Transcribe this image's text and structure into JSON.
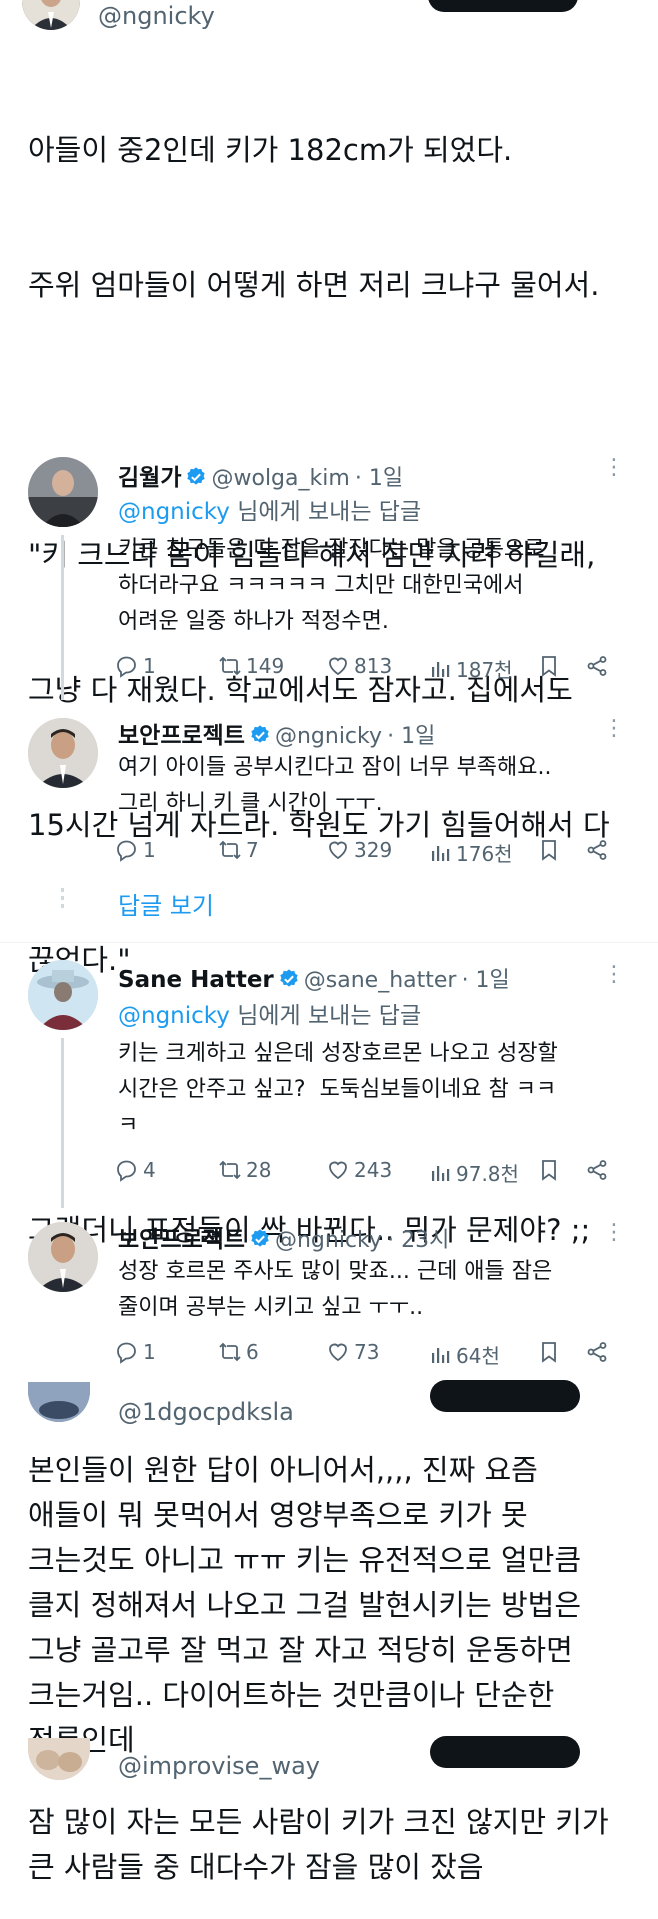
{
  "top_post": {
    "handle": "@ngnicky",
    "text_lines": [
      "아들이 중2인데 키가 182cm가 되었다.",
      "주위 엄마들이 어떻게 하면 저리 크냐구 물어서.",
      "",
      "\"키 크느라 몸이 힘들다 해서 잠만 자려 하길래,",
      "그냥 다 재웠다. 학교에서도 잠자고. 집에서도",
      "15시간 넘게 자드라. 학원도 가기 힘들어해서 다",
      "끊었다.\"",
      "",
      "그랬더니 표정들이 싹 바뀐다.. 뭐가 문제야? ;;"
    ]
  },
  "replies": [
    {
      "name": "김월가",
      "handle": "@wolga_kim",
      "time": "· 1일",
      "reply_to_mention": "@ngnicky",
      "reply_to_suffix": " 님에게 보내는 답글",
      "body": "키큰 친구들은 다 잠을 잘잤다는 말을 공통으로\n하더라구요 ㅋㅋㅋㅋㅋ 그치만 대한민국에서\n어려운 일중 하나가 적정수면.",
      "comments": "1",
      "retweets": "149",
      "likes": "813",
      "views": "187천"
    },
    {
      "name": "보안프로젝트",
      "handle": "@ngnicky",
      "time": "· 1일",
      "body": "여기 아이들 공부시킨다고 잠이 너무 부족해요..\n그리 하니 키 클 시간이 ㅜㅜ.",
      "comments": "1",
      "retweets": "7",
      "likes": "329",
      "views": "176천"
    },
    {
      "name": "Sane Hatter",
      "handle": "@sane_hatter",
      "time": "· 1일",
      "reply_to_mention": "@ngnicky",
      "reply_to_suffix": " 님에게 보내는 답글",
      "body": "키는 크게하고 싶은데 성장호르몬 나오고 성장할\n시간은 안주고 싶고?  도둑심보들이네요 참 ㅋㅋ\nㅋ",
      "comments": "4",
      "retweets": "28",
      "likes": "243",
      "views": "97.8천"
    },
    {
      "name": "보안프로젝트",
      "handle": "@ngnicky",
      "time": "· 23시",
      "body": "성장 호르몬 주사도 많이 맞죠... 근데 애들 잠은\n줄이며 공부는 시키고 싶고 ㅜㅜ..",
      "comments": "1",
      "retweets": "6",
      "likes": "73",
      "views": "64천"
    }
  ],
  "show_replies_label": "답글 보기",
  "post2": {
    "handle": "@1dgocpdksla",
    "text": "본인들이 원한 답이 아니어서,,,, 진짜 요즘\n애들이 뭐 못먹어서 영양부족으로 키가 못\n크는것도 아니고 ㅠㅠ 키는 유전적으로 얼만큼\n클지 정해져서 나오고 그걸 발현시키는 방법은\n그냥 골고루 잘 먹고 잘 자고 적당히 운동하면\n크는거임.. 다이어트하는 것만큼이나 단순한\n정론인데"
  },
  "post3": {
    "handle": "@improvise_way",
    "text": "잠 많이 자는 모든 사람이 키가 크진 않지만 키가\n큰 사람들 중 대다수가 잠을 많이 잤음"
  },
  "icons": {
    "comment": "comment-icon",
    "retweet": "retweet-icon",
    "like": "heart-icon",
    "views": "views-icon",
    "bookmark": "bookmark-icon",
    "share": "share-icon",
    "verified": "verified-badge-icon",
    "more": "more-icon"
  },
  "colors": {
    "link": "#1d9bf0",
    "muted": "#536471",
    "text": "#0f1419"
  }
}
